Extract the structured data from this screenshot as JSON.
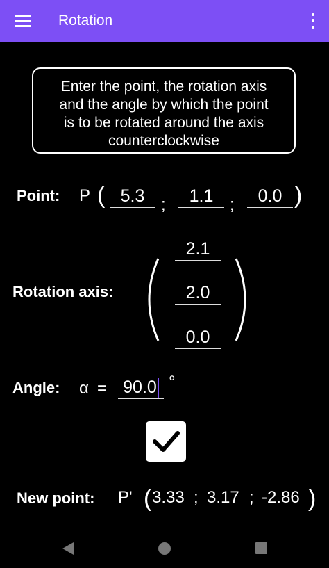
{
  "app_bar": {
    "title": "Rotation",
    "menu_icon": "hamburger-menu-icon",
    "overflow_icon": "more-vert-icon",
    "color": "#7d4ff5"
  },
  "instructions": {
    "lines": [
      "Enter the point, the rotation axis",
      "and the angle by which the point",
      "is to be rotated around the axis",
      "counterclockwise"
    ]
  },
  "point": {
    "label": "Point:",
    "symbol": "P",
    "open_paren": "(",
    "close_paren": ")",
    "separator": ";",
    "x": "5.3",
    "y": "1.1",
    "z": "0.0"
  },
  "axis": {
    "label": "Rotation axis:",
    "x": "2.1",
    "y": "2.0",
    "z": "0.0"
  },
  "angle": {
    "label": "Angle:",
    "symbol": "α",
    "equals": "=",
    "value": "90.0",
    "unit": "°"
  },
  "confirm": {
    "icon": "check-icon",
    "checked": true
  },
  "result": {
    "label": "New point:",
    "symbol": "P'",
    "open_paren": "(",
    "close_paren": ")",
    "x": "3.33",
    "sep1": ";",
    "y": "3.17",
    "sep2": ";",
    "z": "-2.86"
  },
  "nav_bar": {
    "back_icon": "back-triangle-icon",
    "home_icon": "home-circle-icon",
    "recents_icon": "recents-square-icon"
  }
}
